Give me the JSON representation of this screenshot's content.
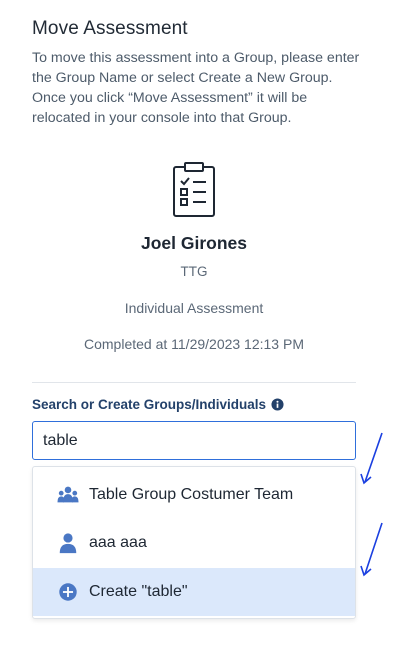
{
  "dialog": {
    "title": "Move Assessment",
    "description": "To move this assessment into a Group, please enter the Group Name or select Create a New Group. Once you click “Move Assessment” it will be relocated in your console into that Group.",
    "icon": "clipboard-checklist-icon"
  },
  "assessment": {
    "person_name": "Joel Girones",
    "organization": "TTG",
    "type": "Individual Assessment",
    "completed": "Completed at 11/29/2023 12:13 PM"
  },
  "search": {
    "label": "Search or Create Groups/Individuals",
    "value": "table",
    "info_icon": "info-circle-icon"
  },
  "dropdown": {
    "options": [
      {
        "label": "Table Group Costumer Team",
        "icon": "group-icon",
        "highlighted": false
      },
      {
        "label": "aaa aaa",
        "icon": "person-icon",
        "highlighted": false
      },
      {
        "label": "Create \"table\"",
        "icon": "plus-circle-icon",
        "highlighted": true
      }
    ]
  },
  "colors": {
    "accent": "#2f6fdb",
    "label_blue": "#23416a",
    "icon_blue": "#4a77c4",
    "highlight_bg": "#dbe8fb",
    "annotation_arrow": "#1a3fe0"
  }
}
